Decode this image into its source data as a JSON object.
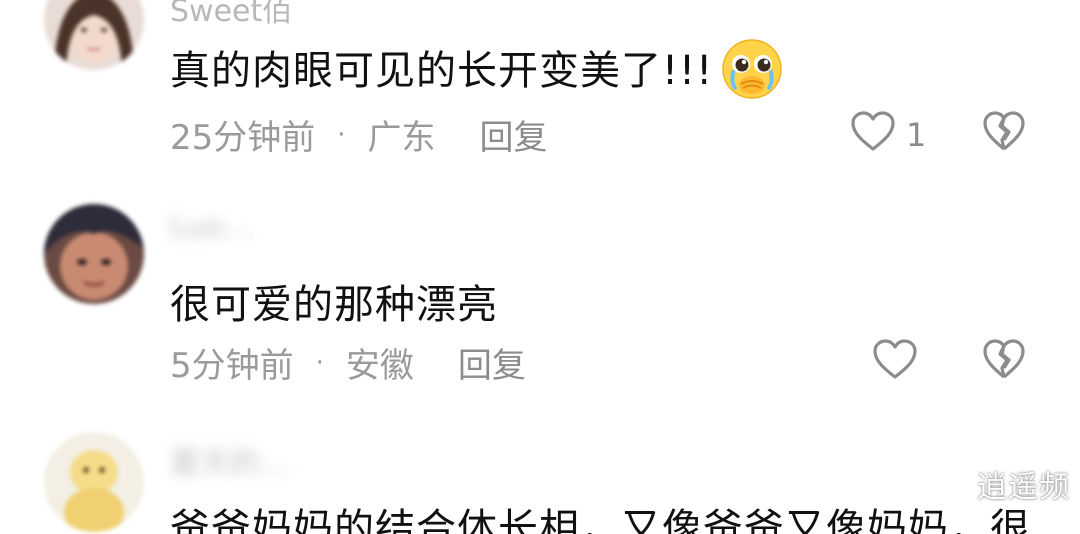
{
  "comments": [
    {
      "username": "Sweet佰",
      "text": "真的肉眼可见的长开变美了!!!",
      "emoji": "pleading-face-emoji",
      "time": "25分钟前",
      "location": "广东",
      "separator": "·",
      "reply_label": "回复",
      "like_count": "1"
    },
    {
      "username": "Luo…",
      "text": "很可爱的那种漂亮",
      "time": "5分钟前",
      "location": "安徽",
      "separator": "·",
      "reply_label": "回复",
      "like_count": ""
    },
    {
      "username": "夏天的…",
      "text": "爸爸妈妈的结合体长相，又像爸爸又像妈妈，很"
    }
  ],
  "watermark": "逍遥频",
  "colors": {
    "text": "#111111",
    "meta": "#9a9a9a",
    "icon": "#8c8c8c"
  }
}
